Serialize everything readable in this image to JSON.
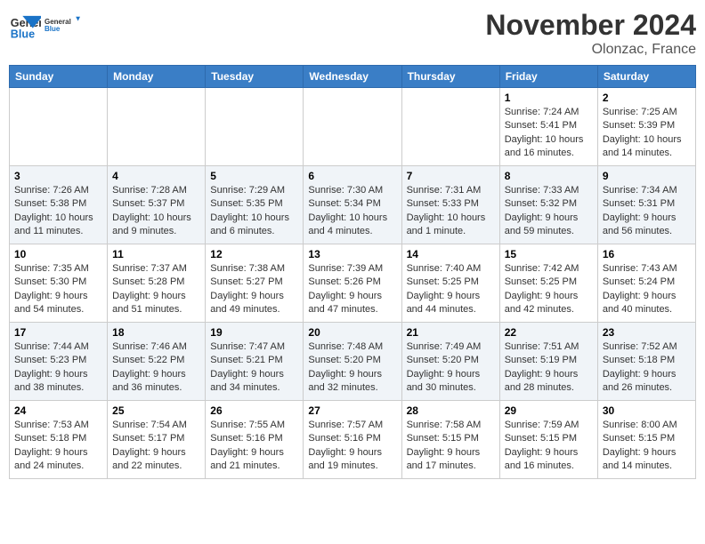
{
  "header": {
    "logo_line1": "General",
    "logo_line2": "Blue",
    "month_title": "November 2024",
    "location": "Olonzac, France"
  },
  "days_of_week": [
    "Sunday",
    "Monday",
    "Tuesday",
    "Wednesday",
    "Thursday",
    "Friday",
    "Saturday"
  ],
  "weeks": [
    [
      {
        "day": "",
        "sunrise": "",
        "sunset": "",
        "daylight": ""
      },
      {
        "day": "",
        "sunrise": "",
        "sunset": "",
        "daylight": ""
      },
      {
        "day": "",
        "sunrise": "",
        "sunset": "",
        "daylight": ""
      },
      {
        "day": "",
        "sunrise": "",
        "sunset": "",
        "daylight": ""
      },
      {
        "day": "",
        "sunrise": "",
        "sunset": "",
        "daylight": ""
      },
      {
        "day": "1",
        "sunrise": "Sunrise: 7:24 AM",
        "sunset": "Sunset: 5:41 PM",
        "daylight": "Daylight: 10 hours and 16 minutes."
      },
      {
        "day": "2",
        "sunrise": "Sunrise: 7:25 AM",
        "sunset": "Sunset: 5:39 PM",
        "daylight": "Daylight: 10 hours and 14 minutes."
      }
    ],
    [
      {
        "day": "3",
        "sunrise": "Sunrise: 7:26 AM",
        "sunset": "Sunset: 5:38 PM",
        "daylight": "Daylight: 10 hours and 11 minutes."
      },
      {
        "day": "4",
        "sunrise": "Sunrise: 7:28 AM",
        "sunset": "Sunset: 5:37 PM",
        "daylight": "Daylight: 10 hours and 9 minutes."
      },
      {
        "day": "5",
        "sunrise": "Sunrise: 7:29 AM",
        "sunset": "Sunset: 5:35 PM",
        "daylight": "Daylight: 10 hours and 6 minutes."
      },
      {
        "day": "6",
        "sunrise": "Sunrise: 7:30 AM",
        "sunset": "Sunset: 5:34 PM",
        "daylight": "Daylight: 10 hours and 4 minutes."
      },
      {
        "day": "7",
        "sunrise": "Sunrise: 7:31 AM",
        "sunset": "Sunset: 5:33 PM",
        "daylight": "Daylight: 10 hours and 1 minute."
      },
      {
        "day": "8",
        "sunrise": "Sunrise: 7:33 AM",
        "sunset": "Sunset: 5:32 PM",
        "daylight": "Daylight: 9 hours and 59 minutes."
      },
      {
        "day": "9",
        "sunrise": "Sunrise: 7:34 AM",
        "sunset": "Sunset: 5:31 PM",
        "daylight": "Daylight: 9 hours and 56 minutes."
      }
    ],
    [
      {
        "day": "10",
        "sunrise": "Sunrise: 7:35 AM",
        "sunset": "Sunset: 5:30 PM",
        "daylight": "Daylight: 9 hours and 54 minutes."
      },
      {
        "day": "11",
        "sunrise": "Sunrise: 7:37 AM",
        "sunset": "Sunset: 5:28 PM",
        "daylight": "Daylight: 9 hours and 51 minutes."
      },
      {
        "day": "12",
        "sunrise": "Sunrise: 7:38 AM",
        "sunset": "Sunset: 5:27 PM",
        "daylight": "Daylight: 9 hours and 49 minutes."
      },
      {
        "day": "13",
        "sunrise": "Sunrise: 7:39 AM",
        "sunset": "Sunset: 5:26 PM",
        "daylight": "Daylight: 9 hours and 47 minutes."
      },
      {
        "day": "14",
        "sunrise": "Sunrise: 7:40 AM",
        "sunset": "Sunset: 5:25 PM",
        "daylight": "Daylight: 9 hours and 44 minutes."
      },
      {
        "day": "15",
        "sunrise": "Sunrise: 7:42 AM",
        "sunset": "Sunset: 5:25 PM",
        "daylight": "Daylight: 9 hours and 42 minutes."
      },
      {
        "day": "16",
        "sunrise": "Sunrise: 7:43 AM",
        "sunset": "Sunset: 5:24 PM",
        "daylight": "Daylight: 9 hours and 40 minutes."
      }
    ],
    [
      {
        "day": "17",
        "sunrise": "Sunrise: 7:44 AM",
        "sunset": "Sunset: 5:23 PM",
        "daylight": "Daylight: 9 hours and 38 minutes."
      },
      {
        "day": "18",
        "sunrise": "Sunrise: 7:46 AM",
        "sunset": "Sunset: 5:22 PM",
        "daylight": "Daylight: 9 hours and 36 minutes."
      },
      {
        "day": "19",
        "sunrise": "Sunrise: 7:47 AM",
        "sunset": "Sunset: 5:21 PM",
        "daylight": "Daylight: 9 hours and 34 minutes."
      },
      {
        "day": "20",
        "sunrise": "Sunrise: 7:48 AM",
        "sunset": "Sunset: 5:20 PM",
        "daylight": "Daylight: 9 hours and 32 minutes."
      },
      {
        "day": "21",
        "sunrise": "Sunrise: 7:49 AM",
        "sunset": "Sunset: 5:20 PM",
        "daylight": "Daylight: 9 hours and 30 minutes."
      },
      {
        "day": "22",
        "sunrise": "Sunrise: 7:51 AM",
        "sunset": "Sunset: 5:19 PM",
        "daylight": "Daylight: 9 hours and 28 minutes."
      },
      {
        "day": "23",
        "sunrise": "Sunrise: 7:52 AM",
        "sunset": "Sunset: 5:18 PM",
        "daylight": "Daylight: 9 hours and 26 minutes."
      }
    ],
    [
      {
        "day": "24",
        "sunrise": "Sunrise: 7:53 AM",
        "sunset": "Sunset: 5:18 PM",
        "daylight": "Daylight: 9 hours and 24 minutes."
      },
      {
        "day": "25",
        "sunrise": "Sunrise: 7:54 AM",
        "sunset": "Sunset: 5:17 PM",
        "daylight": "Daylight: 9 hours and 22 minutes."
      },
      {
        "day": "26",
        "sunrise": "Sunrise: 7:55 AM",
        "sunset": "Sunset: 5:16 PM",
        "daylight": "Daylight: 9 hours and 21 minutes."
      },
      {
        "day": "27",
        "sunrise": "Sunrise: 7:57 AM",
        "sunset": "Sunset: 5:16 PM",
        "daylight": "Daylight: 9 hours and 19 minutes."
      },
      {
        "day": "28",
        "sunrise": "Sunrise: 7:58 AM",
        "sunset": "Sunset: 5:15 PM",
        "daylight": "Daylight: 9 hours and 17 minutes."
      },
      {
        "day": "29",
        "sunrise": "Sunrise: 7:59 AM",
        "sunset": "Sunset: 5:15 PM",
        "daylight": "Daylight: 9 hours and 16 minutes."
      },
      {
        "day": "30",
        "sunrise": "Sunrise: 8:00 AM",
        "sunset": "Sunset: 5:15 PM",
        "daylight": "Daylight: 9 hours and 14 minutes."
      }
    ]
  ]
}
